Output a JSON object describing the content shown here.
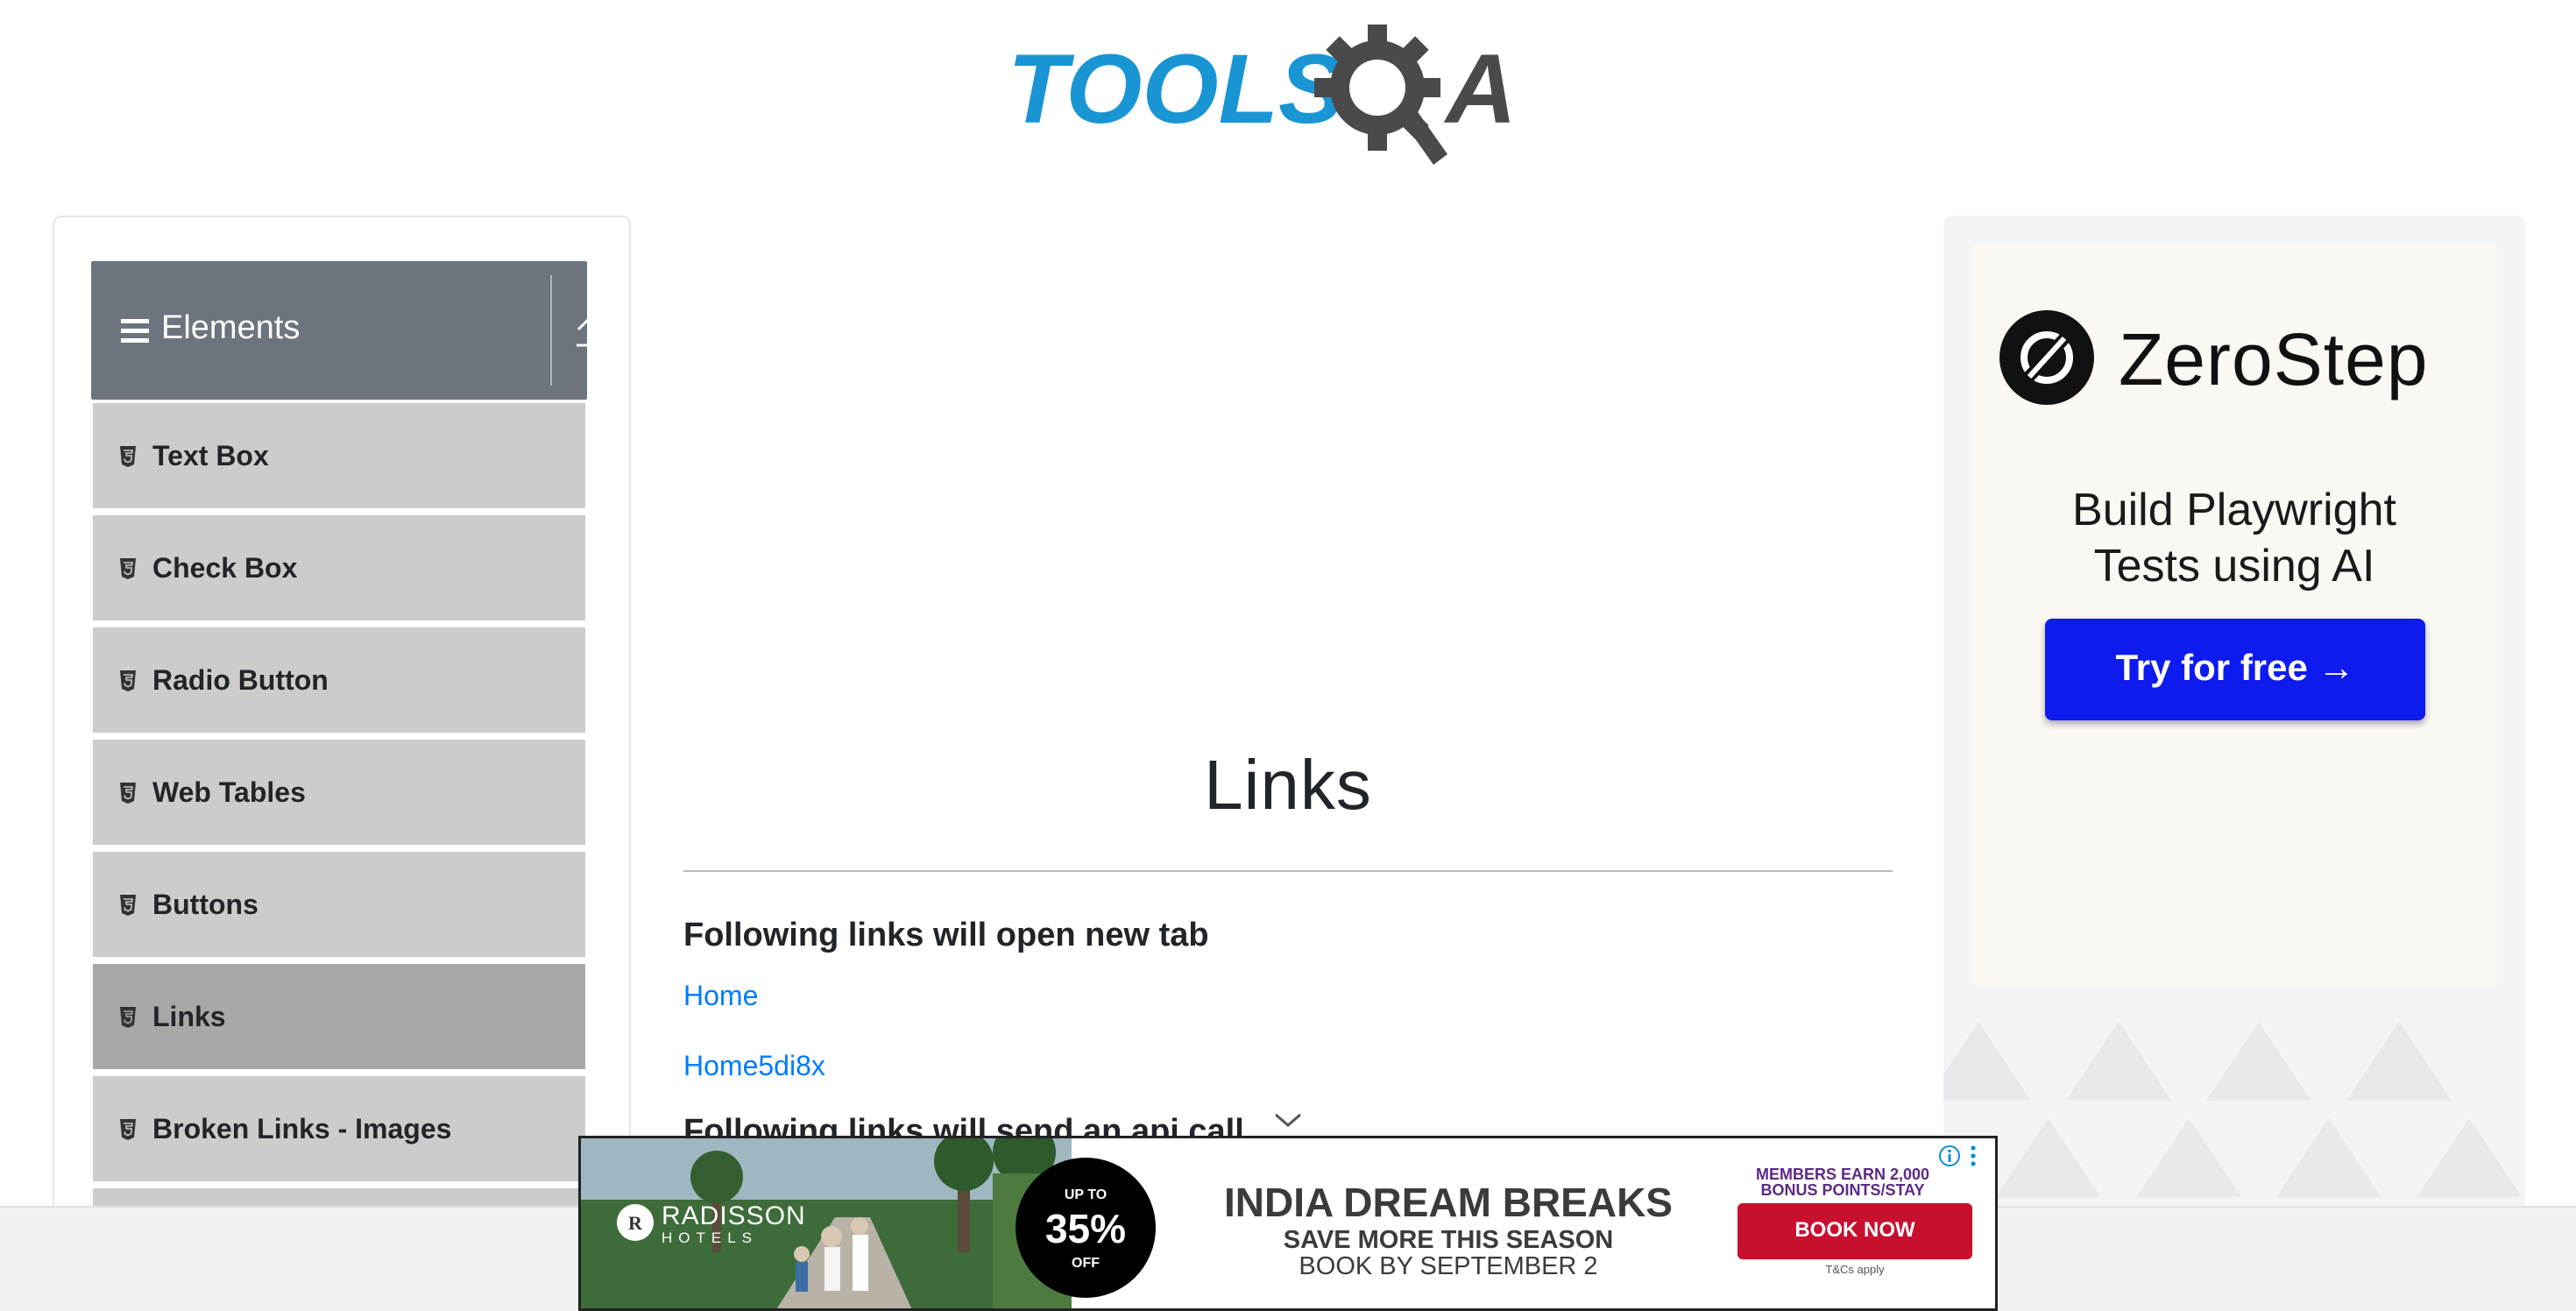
{
  "header": {
    "logo_text_left": "TOOLS",
    "logo_text_right": "A",
    "logo_color_blue": "#1a95d4",
    "logo_color_dark": "#4a4a4a"
  },
  "sidebar": {
    "group_title": "Elements",
    "items": [
      {
        "label": "Text Box",
        "active": false
      },
      {
        "label": "Check Box",
        "active": false
      },
      {
        "label": "Radio Button",
        "active": false
      },
      {
        "label": "Web Tables",
        "active": false
      },
      {
        "label": "Buttons",
        "active": false
      },
      {
        "label": "Links",
        "active": true
      },
      {
        "label": "Broken Links - Images",
        "active": false
      }
    ]
  },
  "main": {
    "title": "Links",
    "section_new_tab": "Following links will open new tab",
    "links_new_tab": [
      "Home",
      "Home5di8x"
    ],
    "section_api": "Following links will send an api call"
  },
  "right_ad": {
    "brand": "ZeroStep",
    "tagline_line1": "Build Playwright",
    "tagline_line2": "Tests using AI",
    "cta": "Try for free →",
    "cta_color": "#0d1bef"
  },
  "bottom_ad": {
    "hotel_brand": "RADISSON",
    "hotel_sub": "HOTELS",
    "badge_top": "UP TO",
    "badge_pct": "35%",
    "badge_bottom": "OFF",
    "headline": "INDIA DREAM BREAKS",
    "subline": "SAVE MORE THIS SEASON",
    "date_line": "BOOK BY SEPTEMBER 2",
    "members_line1": "MEMBERS EARN 2,000",
    "members_line2": "BONUS POINTS/STAY",
    "book_button": "BOOK NOW",
    "terms": "T&Cs apply",
    "button_color": "#c8102e"
  },
  "icons": [
    "hamburger-icon",
    "collapse-arrow-icon",
    "html5-icon",
    "chevron-down-icon",
    "zerostep-logo-icon",
    "radisson-logo-icon",
    "ad-info-icon",
    "ad-menu-icon"
  ]
}
